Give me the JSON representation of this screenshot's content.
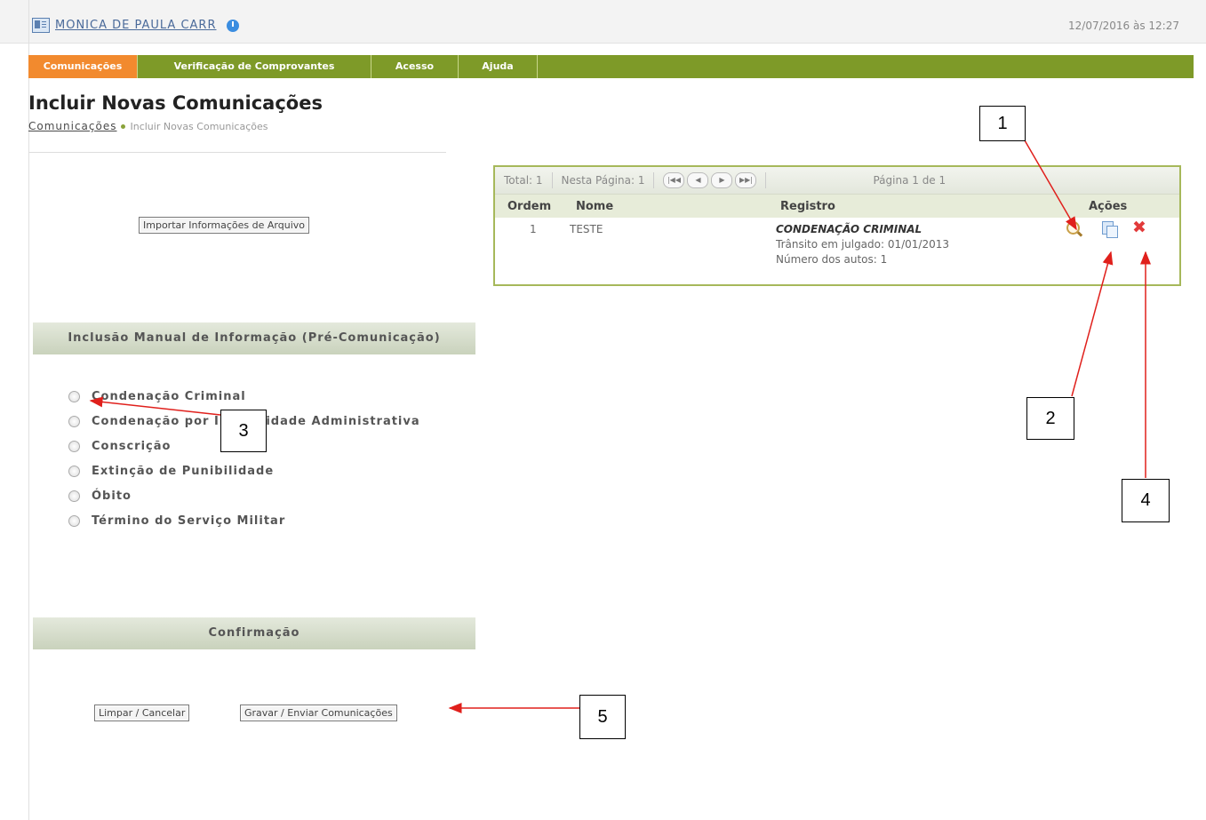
{
  "header": {
    "user_name": "MONICA DE PAULA CARR",
    "datetime": "12/07/2016 às 12:27"
  },
  "nav": {
    "tabs": [
      "Comunicações",
      "Verificação de Comprovantes",
      "Acesso",
      "Ajuda"
    ],
    "active_tab": "Comunicações"
  },
  "page": {
    "title": "Incluir Novas Comunicações",
    "breadcrumb_link": "Comunicações",
    "breadcrumb_current": "Incluir Novas Comunicações"
  },
  "import_button_label": "Importar Informações de Arquivo",
  "manual_section": {
    "title": "Inclusão Manual de Informação (Pré-Comunicação)",
    "options": [
      "Condenação Criminal",
      "Condenação por Improbidade Administrativa",
      "Conscrição",
      "Extinção de Punibilidade",
      "Óbito",
      "Término do Serviço Militar"
    ]
  },
  "confirmation": {
    "title": "Confirmação",
    "clear_label": "Limpar / Cancelar",
    "save_label": "Gravar / Enviar Comunicações"
  },
  "grid": {
    "total_label": "Total: 1",
    "page_count_label": "Nesta Página: 1",
    "page_info": "Página 1 de 1",
    "columns": [
      "Ordem",
      "Nome",
      "Registro",
      "Ações"
    ],
    "rows": [
      {
        "ordem": "1",
        "nome": "TESTE",
        "registro_title": "CONDENAÇÃO CRIMINAL",
        "registro_line1": "Trânsito em julgado: 01/01/2013",
        "registro_line2": "Número dos autos: 1"
      }
    ]
  },
  "callouts": [
    "1",
    "2",
    "3",
    "4",
    "5"
  ],
  "colors": {
    "nav_bar": "#7e9a28",
    "active_tab": "#f28a2e",
    "grid_border": "#a6b85a",
    "callout_arrow": "#e0201c"
  },
  "icons": {
    "user": "user-card-icon",
    "logout": "power-icon",
    "view": "magnifier-icon",
    "copy": "copy-icon",
    "delete": "delete-icon"
  }
}
